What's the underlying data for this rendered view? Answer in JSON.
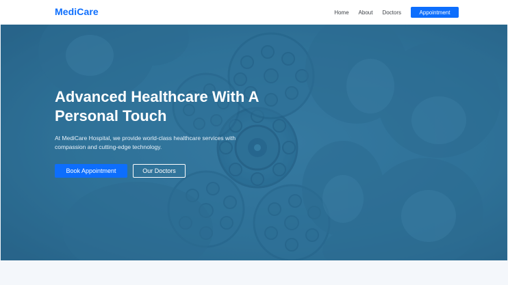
{
  "navbar": {
    "brand": "MediCare",
    "links": [
      "Home",
      "About",
      "Doctors"
    ],
    "cta_label": "Appointment"
  },
  "hero": {
    "title": "Advanced Healthcare With A Personal Touch",
    "subtitle": "At MediCare Hospital, we provide world-class healthcare services with compassion and cutting-edge technology.",
    "primary_button": "Book Appointment",
    "secondary_button": "Our Doctors",
    "background_image": "surgical-lights-and-surgeons"
  },
  "colors": {
    "brand": "#0d6efd",
    "hero_overlay": "#2d6f95",
    "page_bg": "#f4f7fb",
    "text_dark": "#3b3f45"
  }
}
